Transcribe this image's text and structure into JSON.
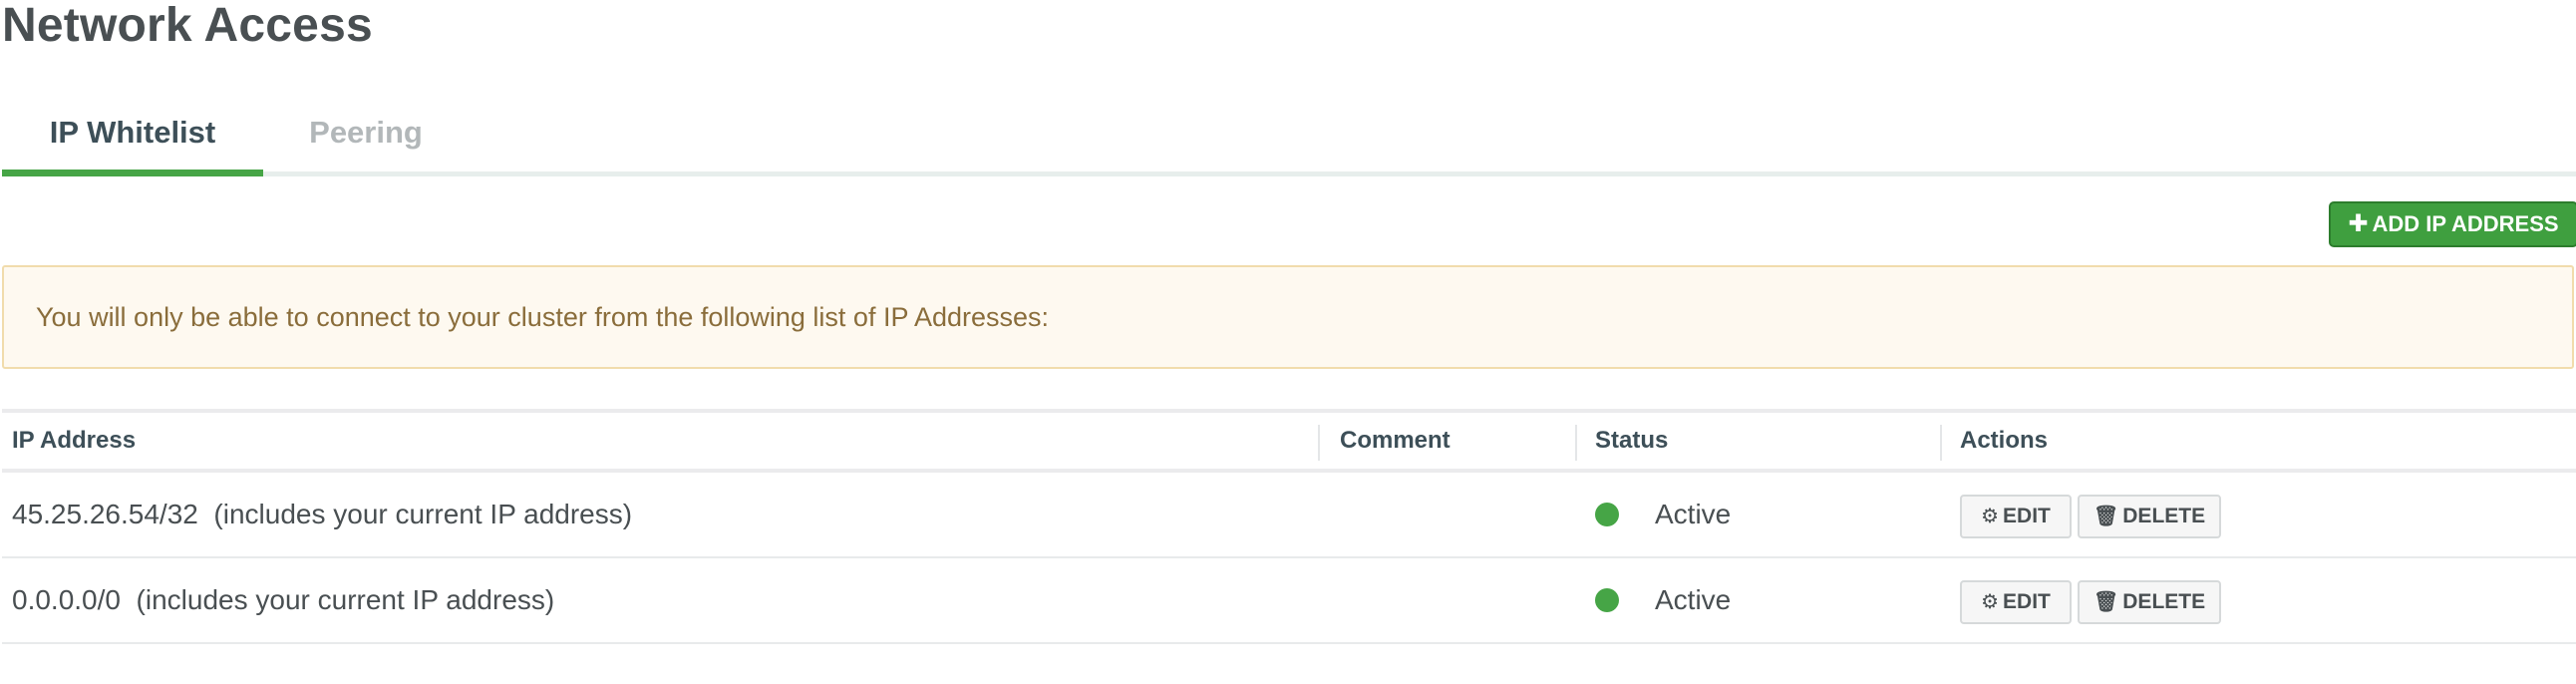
{
  "page": {
    "title": "Network Access"
  },
  "tabs": [
    {
      "label": "IP Whitelist",
      "active": true
    },
    {
      "label": "Peering",
      "active": false
    }
  ],
  "toolbar": {
    "add_icon": "plus-icon",
    "add_label": "ADD IP ADDRESS"
  },
  "notice": {
    "text": "You will only be able to connect to your cluster from the following list of IP Addresses:"
  },
  "table": {
    "headers": {
      "ip": "IP Address",
      "comment": "Comment",
      "status": "Status",
      "actions": "Actions"
    },
    "rows": [
      {
        "ip": "45.25.26.54/32",
        "ip_note": "(includes your current IP address)",
        "comment": "",
        "status": "Active",
        "edit_label": "EDIT",
        "delete_label": "DELETE"
      },
      {
        "ip": "0.0.0.0/0",
        "ip_note": "(includes your current IP address)",
        "comment": "",
        "status": "Active",
        "edit_label": "EDIT",
        "delete_label": "DELETE"
      }
    ]
  },
  "colors": {
    "accent_green": "#46a546",
    "notice_bg": "#fef9f0",
    "notice_text": "#8a6d3b"
  }
}
